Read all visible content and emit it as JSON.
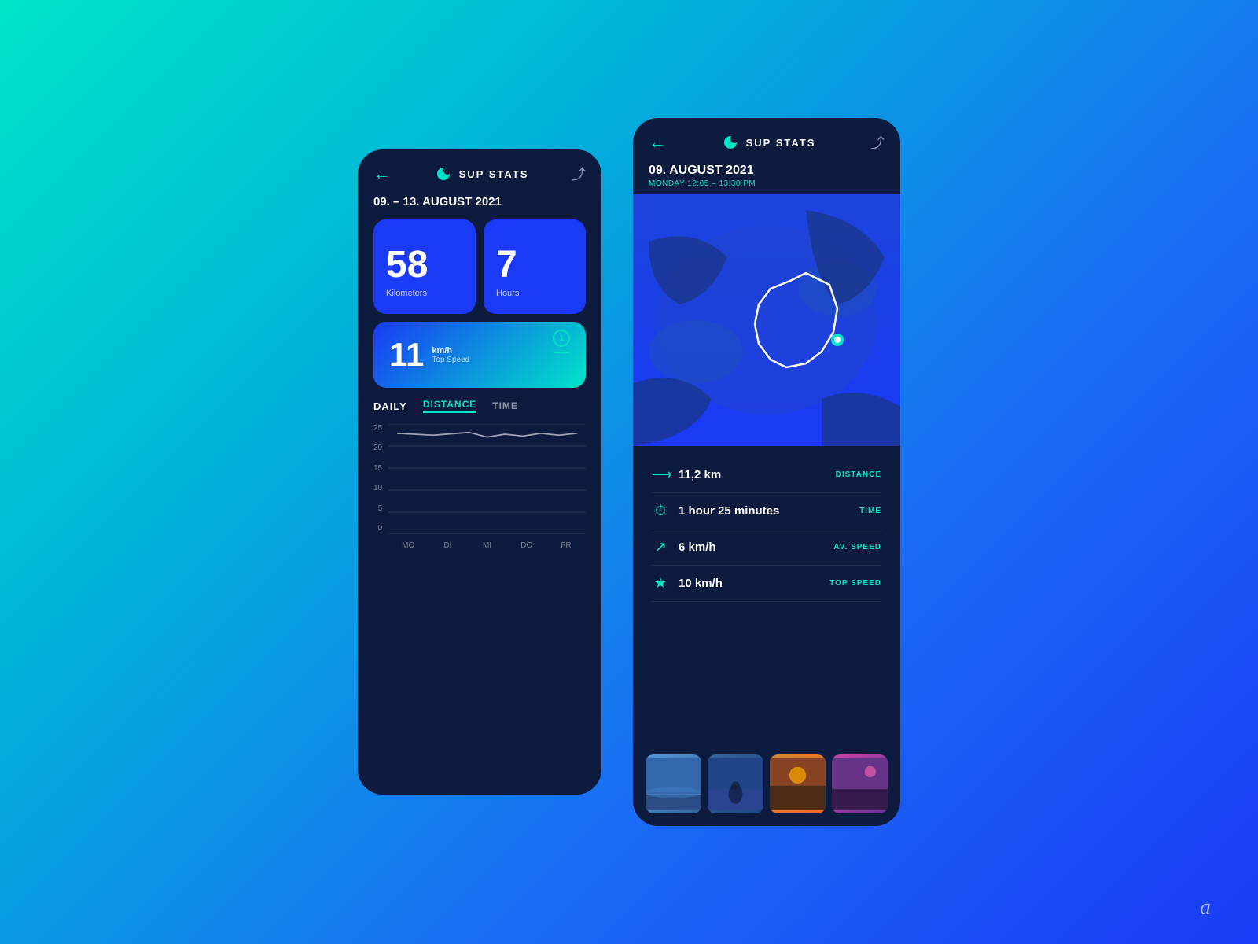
{
  "background": {
    "gradient_start": "#00e5c8",
    "gradient_end": "#1a3af5"
  },
  "phone1": {
    "header": {
      "back_label": "←",
      "app_name": "SUP STATS",
      "share_icon": "⤴"
    },
    "date_range": "09. – 13. AUGUST 2021",
    "stat_km": {
      "value": "58",
      "label": "Kilometers"
    },
    "stat_hours": {
      "value": "7",
      "label": "Hours"
    },
    "top_speed": {
      "value": "11",
      "unit": "km/h",
      "label": "Top Speed",
      "badge": "1"
    },
    "daily": {
      "title": "DAILY",
      "tab_distance": "DISTANCE",
      "tab_time": "TIME",
      "y_labels": [
        "25",
        "20",
        "15",
        "10",
        "5",
        "0"
      ],
      "x_labels": [
        "MO",
        "DI",
        "MI",
        "DO",
        "FR"
      ]
    }
  },
  "phone2": {
    "header": {
      "back_label": "←",
      "app_name": "SUP STATS",
      "share_icon": "⤴"
    },
    "date": "09. AUGUST 2021",
    "subdate": "MONDAY 12:05 – 13:30 PM",
    "stats": [
      {
        "icon": "→",
        "value": "11,2 km",
        "key": "DISTANCE"
      },
      {
        "icon": "⏱",
        "value": "1 hour 25 minutes",
        "key": "TIME"
      },
      {
        "icon": "↗",
        "value": "6 km/h",
        "key": "AV. SPEED"
      },
      {
        "icon": "★",
        "value": "10 km/h",
        "key": "TOP SPEED"
      }
    ],
    "photos": [
      "sky-lake",
      "person-water",
      "sunset-lake",
      "pink-sky"
    ]
  },
  "watermark": "a"
}
